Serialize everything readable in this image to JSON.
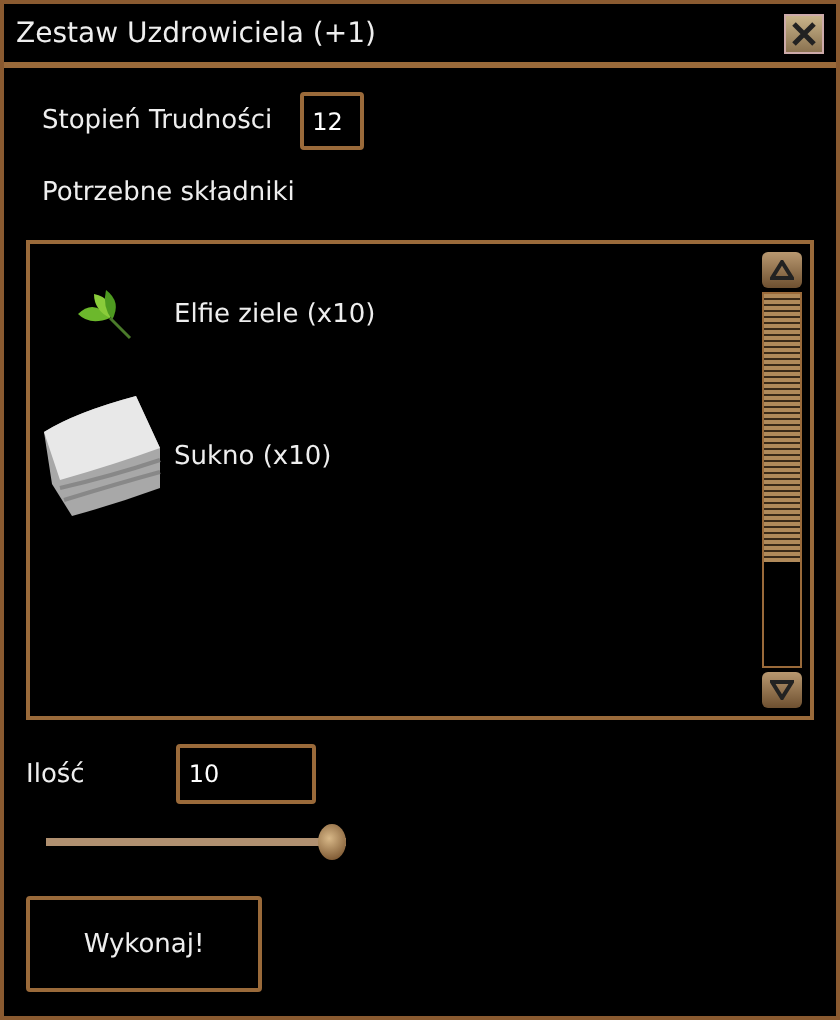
{
  "window": {
    "title": "Zestaw Uzdrowiciela (+1)"
  },
  "difficulty": {
    "label": "Stopień Trudności",
    "value": "12"
  },
  "ingredients": {
    "heading": "Potrzebne składniki",
    "items": [
      {
        "kind": "herb",
        "label": "Elfie ziele (x10)"
      },
      {
        "kind": "cloth",
        "label": "Sukno (x10)"
      }
    ]
  },
  "quantity": {
    "label": "Ilość",
    "value": "10",
    "level": 1
  },
  "button": "Wykonaj!"
}
